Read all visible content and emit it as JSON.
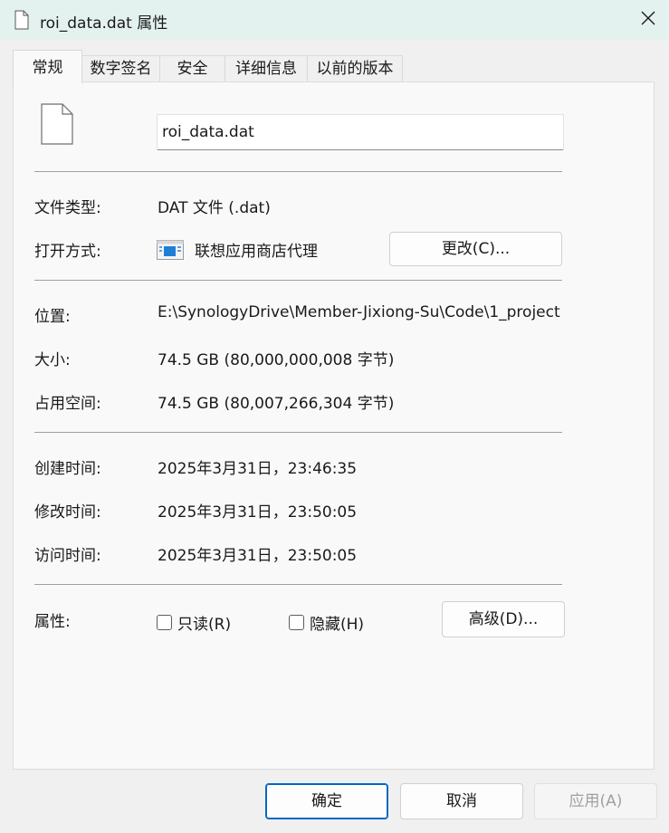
{
  "window": {
    "title": "roi_data.dat 属性",
    "icons": {
      "title": "document-icon",
      "close": "close-icon"
    }
  },
  "tabs": [
    {
      "label": "常规",
      "active": true
    },
    {
      "label": "数字签名",
      "active": false
    },
    {
      "label": "安全",
      "active": false
    },
    {
      "label": "详细信息",
      "active": false
    },
    {
      "label": "以前的版本",
      "active": false
    }
  ],
  "general": {
    "file_name": "roi_data.dat",
    "file_type": {
      "label": "文件类型:",
      "value": "DAT 文件 (.dat)"
    },
    "opens_with": {
      "label": "打开方式:",
      "value": "联想应用商店代理",
      "change_button": "更改(C)...",
      "app_icon": "store-app-icon"
    },
    "location": {
      "label": "位置:",
      "value": "E:\\SynologyDrive\\Member-Jixiong-Su\\Code\\1_project"
    },
    "size": {
      "label": "大小:",
      "value": "74.5 GB (80,000,000,008 字节)"
    },
    "size_on_disk": {
      "label": "占用空间:",
      "value": "74.5 GB (80,007,266,304 字节)"
    },
    "created": {
      "label": "创建时间:",
      "value": "2025年3月31日，23:46:35"
    },
    "modified": {
      "label": "修改时间:",
      "value": "2025年3月31日，23:50:05"
    },
    "accessed": {
      "label": "访问时间:",
      "value": "2025年3月31日，23:50:05"
    },
    "attributes": {
      "label": "属性:",
      "readonly": {
        "label": "只读(R)",
        "checked": false
      },
      "hidden": {
        "label": "隐藏(H)",
        "checked": false
      },
      "advanced_button": "高级(D)..."
    }
  },
  "footer": {
    "ok": "确定",
    "cancel": "取消",
    "apply": "应用(A)"
  },
  "colors": {
    "titlebar": "#e3f2ee",
    "accent": "#0067c0",
    "panel": "#f9f9f9"
  }
}
